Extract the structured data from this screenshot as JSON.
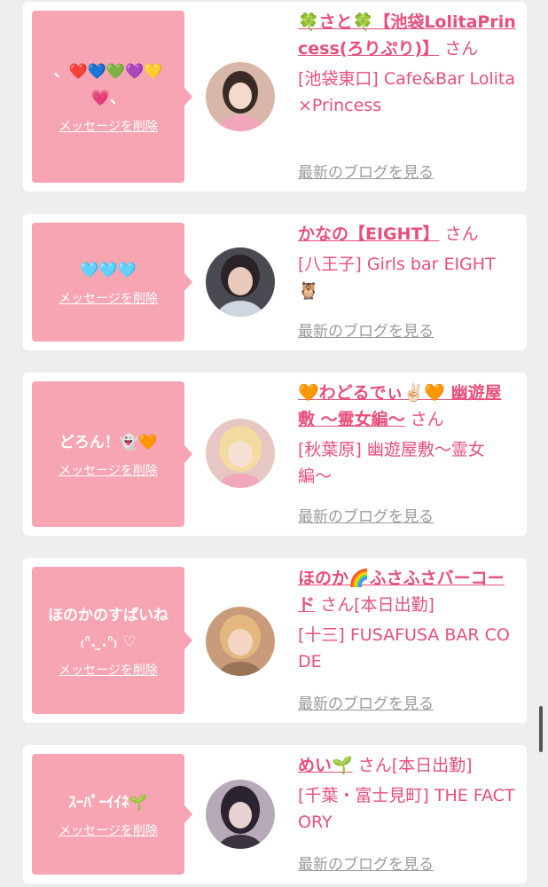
{
  "messages": [
    {
      "message": "、❤️💙💚💜💛💗、",
      "delete_label": "メッセージを削除",
      "name": "🍀さと🍀【池袋LolitaPrincess(ろりぷり)】",
      "honorific": "さん",
      "shop": "[池袋東口] Cafe&Bar Lolita×Princess",
      "blog_label": "最新のブログを見る",
      "avatar_colors": {
        "bg": "#d8b7a8",
        "hair": "#3a2a26",
        "face": "#f4d9cc",
        "clothes": "#f2a6bb"
      }
    },
    {
      "message": "🩵🩵🩵",
      "delete_label": "メッセージを削除",
      "name": "かなの【EIGHT】",
      "honorific": "さん",
      "shop": "[八王子] Girls bar EIGHT 🦉",
      "blog_label": "最新のブログを見る",
      "avatar_colors": {
        "bg": "#4a4a52",
        "hair": "#2a2226",
        "face": "#e8c9bb",
        "clothes": "#cfd6e0"
      }
    },
    {
      "message": "どろん！👻🧡",
      "delete_label": "メッセージを削除",
      "name": "🧡わどるでぃ✌🏻🧡 幽遊屋敷 〜霊女編〜",
      "honorific": "さん",
      "shop": "[秋葉原] 幽遊屋敷〜霊女編〜",
      "blog_label": "最新のブログを見る",
      "avatar_colors": {
        "bg": "#e7c7c3",
        "hair": "#f3dca0",
        "face": "#f6dfd3",
        "clothes": "#f0a7b9"
      }
    },
    {
      "message": "ほのかのすぱいね ₍ᐢ. ̫.ᐢ₎ ♡",
      "delete_label": "メッセージを削除",
      "name": "ほのか🌈ふさふさバーコード",
      "honorific": "さん[本日出勤]",
      "shop": "[十三] FUSAFUSA BAR CODE",
      "blog_label": "最新のブログを見る",
      "avatar_colors": {
        "bg": "#c99b7a",
        "hair": "#e3b77e",
        "face": "#f4d4c2",
        "clothes": "#9a7456"
      }
    },
    {
      "message": "ｽｰﾊﾟｰｲｲﾈ🌱",
      "delete_label": "メッセージを削除",
      "name": "めい🌱",
      "honorific": "さん[本日出勤]",
      "shop": "[千葉・富士見町] THE FACTORY",
      "blog_label": "最新のブログを見る",
      "avatar_colors": {
        "bg": "#b6aab8",
        "hair": "#2b2430",
        "face": "#e8d2d0",
        "clothes": "#3a3340"
      }
    }
  ]
}
